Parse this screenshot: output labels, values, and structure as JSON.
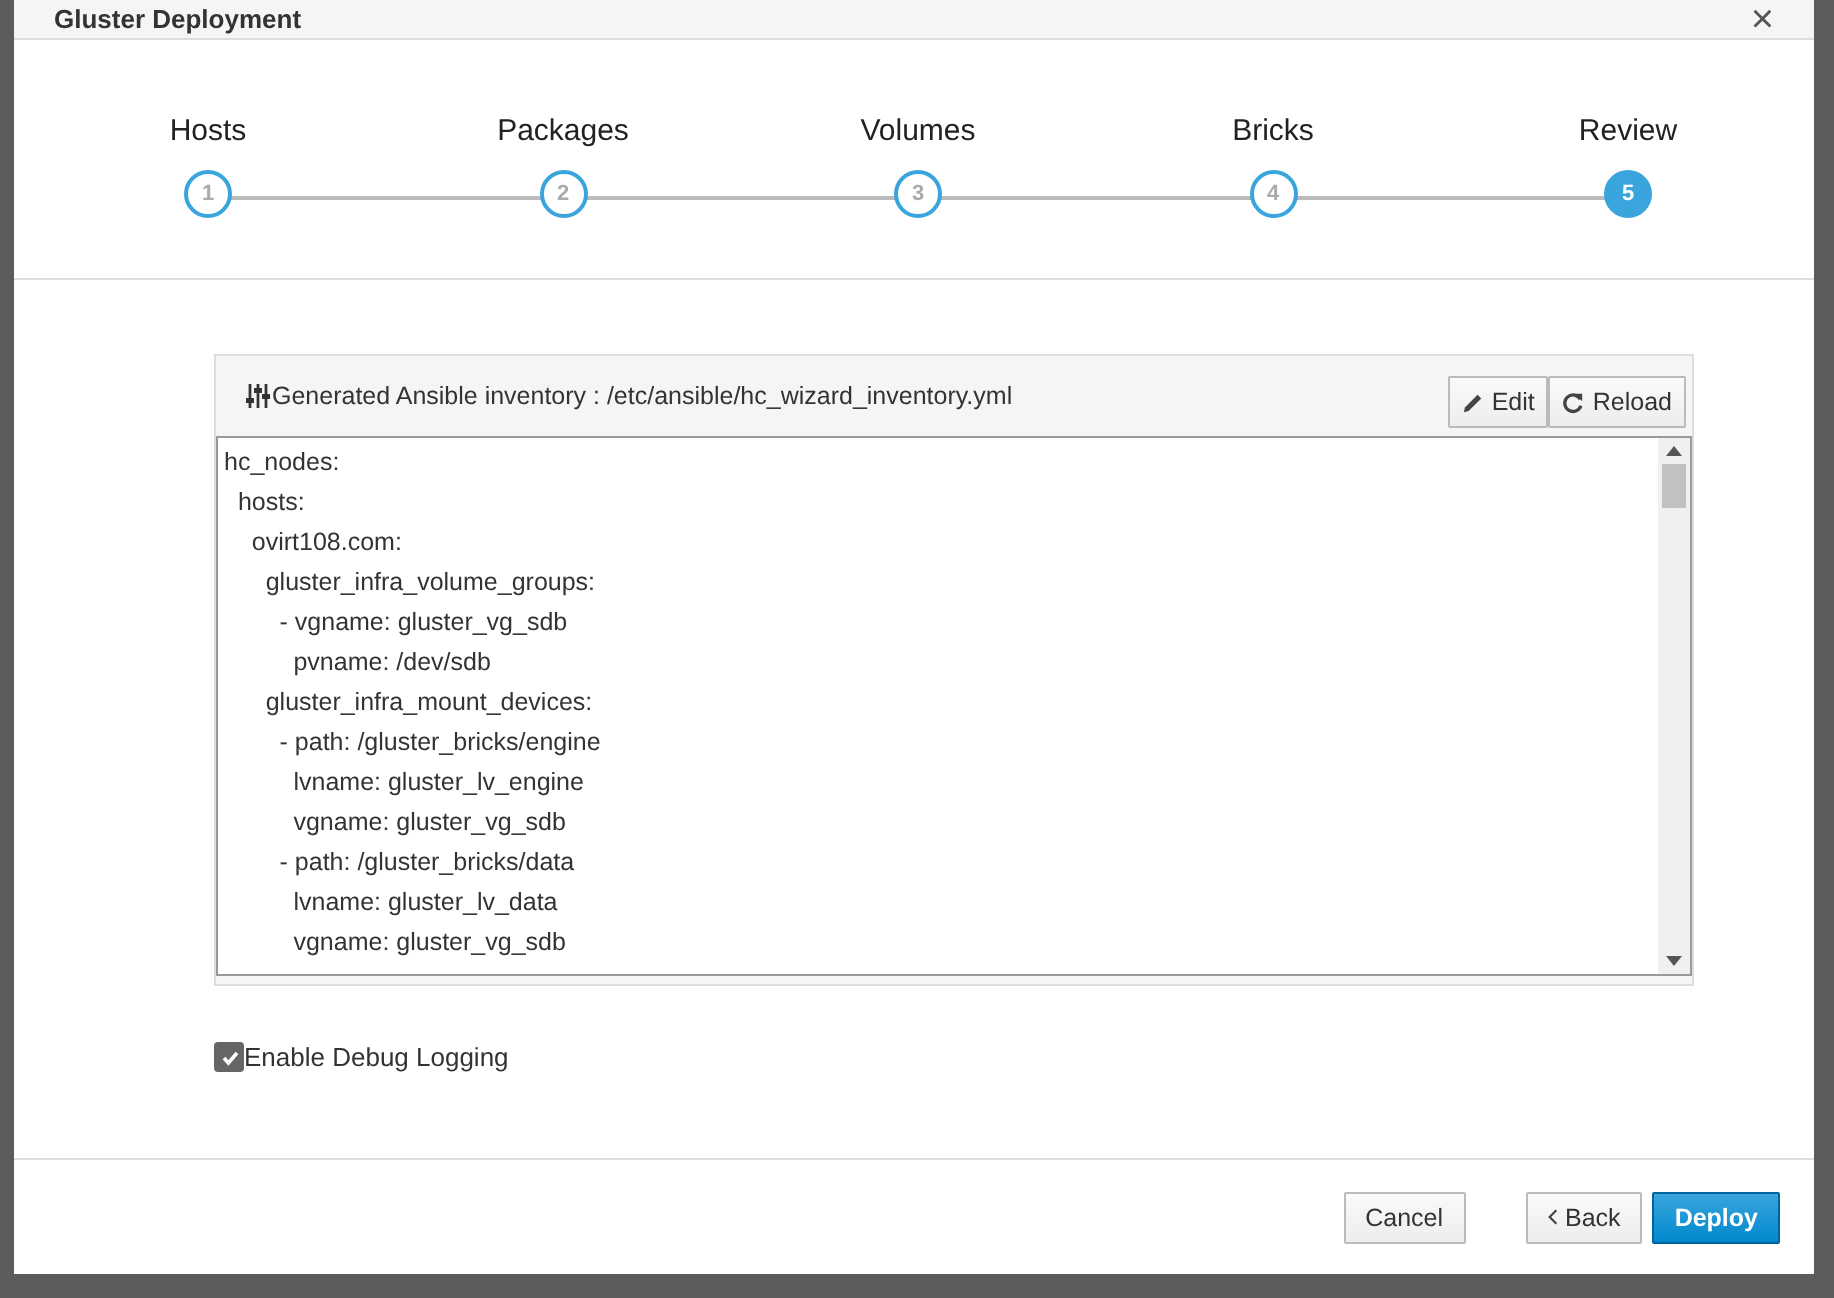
{
  "window": {
    "title": "Gluster Deployment",
    "close": "×"
  },
  "steps": [
    {
      "label": "Hosts",
      "number": "1",
      "selected": false
    },
    {
      "label": "Packages",
      "number": "2",
      "selected": false
    },
    {
      "label": "Volumes",
      "number": "3",
      "selected": false
    },
    {
      "label": "Bricks",
      "number": "4",
      "selected": false
    },
    {
      "label": "Review",
      "number": "5",
      "selected": true
    }
  ],
  "inventory": {
    "title": "Generated Ansible inventory : /etc/ansible/hc_wizard_inventory.yml",
    "buttons": [
      {
        "kind": "edit",
        "label": "Edit"
      },
      {
        "kind": "reload",
        "label": "Reload"
      }
    ],
    "content": "hc_nodes:\n  hosts:\n    ovirt108.com:\n      gluster_infra_volume_groups:\n        - vgname: gluster_vg_sdb\n          pvname: /dev/sdb\n      gluster_infra_mount_devices:\n        - path: /gluster_bricks/engine\n          lvname: gluster_lv_engine\n          vgname: gluster_vg_sdb\n        - path: /gluster_bricks/data\n          lvname: gluster_lv_data\n          vgname: gluster_vg_sdb"
  },
  "debug_logging": {
    "label": "Enable Debug Logging",
    "checked": true
  },
  "footer": {
    "cancel": "Cancel",
    "back": "Back",
    "deploy": "Deploy"
  }
}
